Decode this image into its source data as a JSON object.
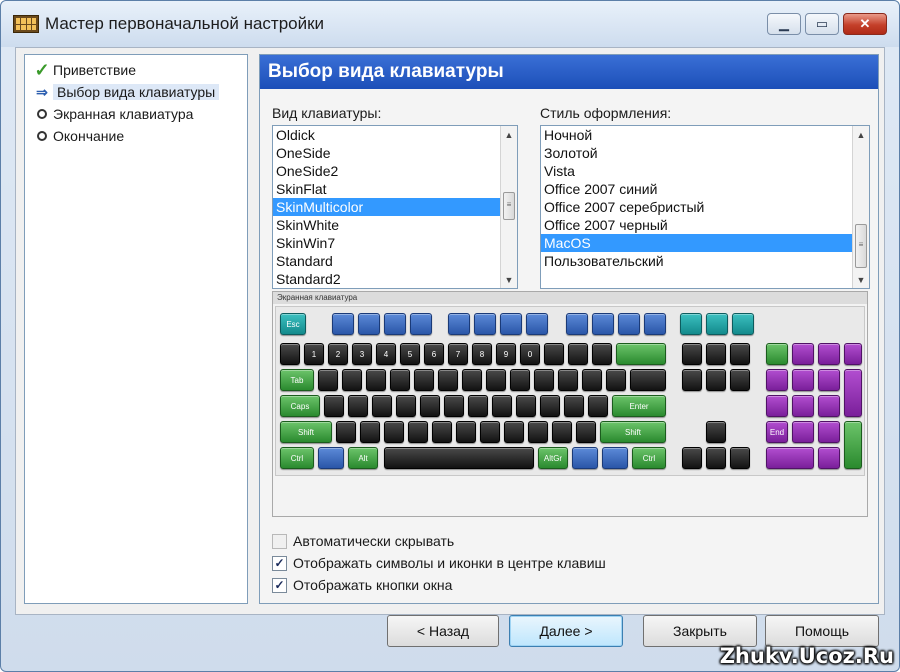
{
  "window": {
    "title": "Мастер первоначальной настройки",
    "controls": {
      "minimize": "▁",
      "maximize": "▭",
      "close": "✕"
    }
  },
  "steps": [
    {
      "label": "Приветствие",
      "icon": "check-icon"
    },
    {
      "label": "Выбор вида клавиатуры",
      "icon": "arrow-right-icon"
    },
    {
      "label": "Экранная клавиатура",
      "icon": "bullet-icon"
    },
    {
      "label": "Окончание",
      "icon": "bullet-icon"
    }
  ],
  "page": {
    "header": "Выбор вида клавиатуры",
    "keyboard_type_label": "Вид клавиатуры:",
    "keyboard_types": [
      "Oldick",
      "OneSide",
      "OneSide2",
      "SkinFlat",
      "SkinMulticolor",
      "SkinWhite",
      "SkinWin7",
      "Standard",
      "Standard2"
    ],
    "keyboard_type_selected": "SkinMulticolor",
    "style_label": "Стиль оформления:",
    "styles": [
      "Ночной",
      "Золотой",
      "Vista",
      "Office 2007 синий",
      "Office 2007 серебристый",
      "Office 2007 черный",
      "MacOS",
      "Пользовательский"
    ],
    "style_selected": "MacOS",
    "preview_title": "Экранная клавиатура",
    "options": [
      {
        "label": "Автоматически скрывать",
        "checked": false,
        "enabled": false
      },
      {
        "label": "Отображать символы и иконки в центре клавиш",
        "checked": true,
        "enabled": true
      },
      {
        "label": "Отображать кнопки окна",
        "checked": true,
        "enabled": true
      }
    ]
  },
  "buttons": {
    "back": "< Назад",
    "next": "Далее >",
    "close": "Закрыть",
    "help": "Помощь"
  },
  "watermark": "Zhukv.Ucoz.Ru",
  "colors": {
    "header_blue": "#1c4fb8",
    "selection_blue": "#3399ff",
    "key_dark": "#121212",
    "key_green": "#2a8a2e",
    "key_blue": "#2a56a8",
    "key_teal": "#138a8c",
    "key_purple": "#7a1f9a"
  }
}
